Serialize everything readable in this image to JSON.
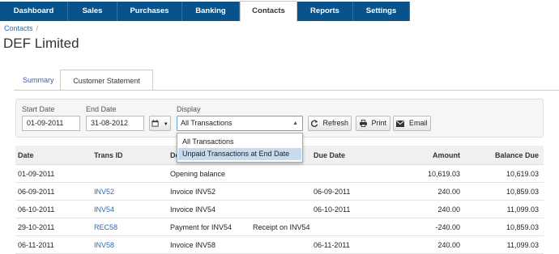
{
  "topnav": {
    "tabs": [
      {
        "label": "Dashboard"
      },
      {
        "label": "Sales"
      },
      {
        "label": "Purchases"
      },
      {
        "label": "Banking"
      },
      {
        "label": "Contacts"
      },
      {
        "label": "Reports"
      },
      {
        "label": "Settings"
      }
    ],
    "active": "Contacts",
    "colors": {
      "bar": "#08538b",
      "link": "#2a6bb5"
    }
  },
  "breadcrumb": {
    "label": "Contacts",
    "separator": "/"
  },
  "page_title": "DEF Limited",
  "subtabs": {
    "summary": "Summary",
    "statement": "Customer Statement"
  },
  "filters": {
    "start_label": "Start Date",
    "start_value": "01-09-2011",
    "end_label": "End Date",
    "end_value": "31-08-2012",
    "display_label": "Display",
    "display_value": "All Transactions",
    "options": [
      "All Transactions",
      "Unpaid Transactions at End Date"
    ],
    "highlighted_option": "Unpaid Transactions at End Date",
    "refresh": "Refresh",
    "print": "Print",
    "email": "Email"
  },
  "table": {
    "headers": {
      "date": "Date",
      "trans_id": "Trans ID",
      "details": "De",
      "due_date": "Due Date",
      "amount": "Amount",
      "balance": "Balance Due"
    },
    "rows": [
      {
        "date": "01-09-2011",
        "trans_id": "",
        "details": "Opening balance",
        "ref": "",
        "due": "",
        "amount": "10,619.03",
        "balance": "10,619.03"
      },
      {
        "date": "06-09-2011",
        "trans_id": "INV52",
        "details": "Invoice INV52",
        "ref": "",
        "due": "06-09-2011",
        "amount": "240.00",
        "balance": "10,859.03"
      },
      {
        "date": "06-10-2011",
        "trans_id": "INV54",
        "details": "Invoice INV54",
        "ref": "",
        "due": "06-10-2011",
        "amount": "240.00",
        "balance": "11,099.03"
      },
      {
        "date": "29-10-2011",
        "trans_id": "REC58",
        "details": "Payment for INV54",
        "ref": "Receipt on INV54",
        "due": "",
        "amount": "-240.00",
        "balance": "10,859.03"
      },
      {
        "date": "06-11-2011",
        "trans_id": "INV58",
        "details": "Invoice INV58",
        "ref": "",
        "due": "06-11-2011",
        "amount": "240.00",
        "balance": "11,099.03"
      }
    ]
  }
}
